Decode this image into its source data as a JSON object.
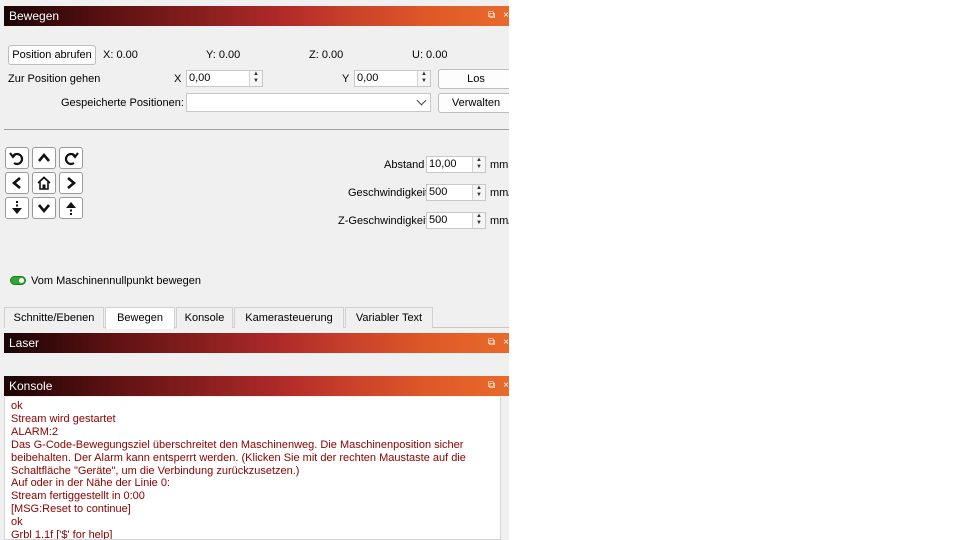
{
  "move_panel": {
    "title": "Bewegen",
    "controls": {
      "float": "⧉",
      "close": "×"
    },
    "get_position_button": "Position abrufen",
    "coords": {
      "x": "X: 0.00",
      "y": "Y: 0.00",
      "z": "Z: 0.00",
      "u": "U: 0.00"
    },
    "goto_label": "Zur Position gehen",
    "goto_x_label": "X",
    "goto_x_value": "0,00",
    "goto_y_label": "Y",
    "goto_y_value": "0,00",
    "go_button": "Los",
    "saved_positions_label": "Gespeicherte Positionen:",
    "saved_positions_value": "",
    "manage_button": "Verwalten",
    "distance_label": "Abstand",
    "distance_value": "10,00",
    "distance_unit": "mm",
    "speed_label": "Geschwindigkeit",
    "speed_value": "500",
    "speed_unit": "mm/",
    "zspeed_label": "Z-Geschwindigkeit",
    "zspeed_value": "500",
    "zspeed_unit": "mm/",
    "machine_zero_toggle_label": "Vom Maschinennullpunkt bewegen",
    "machine_zero_toggle_on": true,
    "jog_buttons": [
      "rotate-ccw-icon",
      "arrow-up-icon",
      "rotate-cw-icon",
      "arrow-left-icon",
      "home-icon",
      "arrow-right-icon",
      "z-down-icon",
      "arrow-down-icon",
      "z-up-icon"
    ]
  },
  "tabs": [
    {
      "label": "Schnitte/Ebenen",
      "active": false
    },
    {
      "label": "Bewegen",
      "active": true
    },
    {
      "label": "Konsole",
      "active": false
    },
    {
      "label": "Kamerasteuerung",
      "active": false
    },
    {
      "label": "Variabler Text",
      "active": false
    }
  ],
  "laser_panel": {
    "title": "Laser",
    "controls": {
      "float": "⧉",
      "close": "×"
    }
  },
  "console_panel": {
    "title": "Konsole",
    "controls": {
      "float": "⧉",
      "close": "×"
    },
    "text_color": "#8b0000",
    "lines": [
      "ok",
      "Stream wird gestartet",
      "ALARM:2",
      "Das G-Code-Bewegungsziel überschreitet den Maschinenweg. Die Maschinenposition sicher",
      "beibehalten. Der Alarm kann entsperrt werden. (Klicken Sie mit der rechten Maustaste auf die",
      "Schaltfläche \"Geräte\", um die Verbindung zurückzusetzen.)",
      "Auf oder in der Nähe der Linie 0:",
      "Stream fertiggestellt in 0:00",
      "[MSG:Reset to continue]",
      "ok",
      "Grbl 1.1f ['$' for help]"
    ]
  },
  "theme": {
    "title_gradient_start": "#1a0505",
    "title_gradient_end": "#e86a2a",
    "toggle_on": "#2fa82f"
  }
}
